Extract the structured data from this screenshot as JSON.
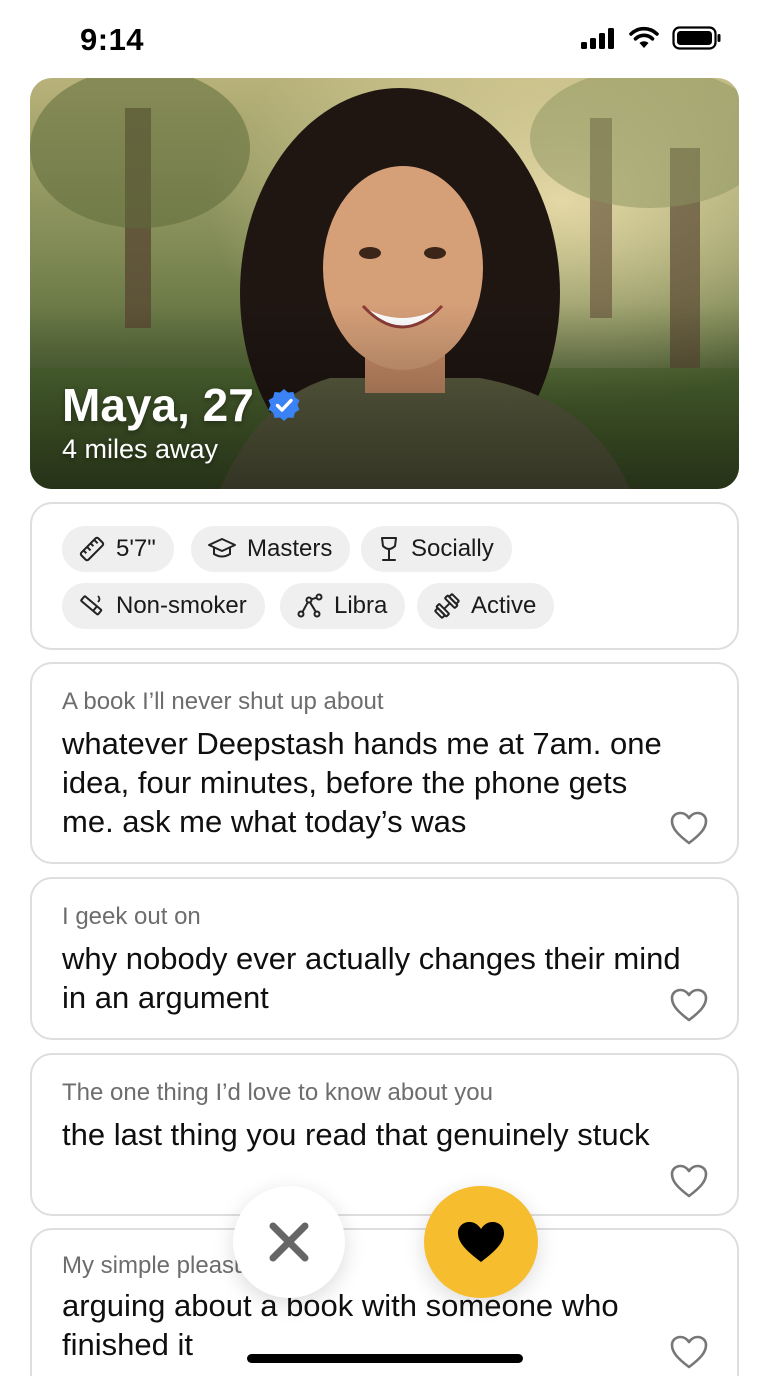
{
  "status_bar": {
    "time": "9:14"
  },
  "profile": {
    "name_age": "Maya, 27",
    "distance": "4 miles away"
  },
  "chips": [
    {
      "label": "5'7\"",
      "icon": "ruler-icon"
    },
    {
      "label": "Masters",
      "icon": "graduation-cap-icon"
    },
    {
      "label": "Socially",
      "icon": "wine-glass-icon"
    },
    {
      "label": "Non-smoker",
      "icon": "no-smoking-icon"
    },
    {
      "label": "Libra",
      "icon": "zodiac-constellation-icon"
    },
    {
      "label": "Active",
      "icon": "dumbbell-icon"
    }
  ],
  "prompts": [
    {
      "label": "A book I’ll never shut up about",
      "answer": "whatever Deepstash hands me at 7am. one idea, four minutes, before the phone gets me. ask me what today’s was"
    },
    {
      "label": "I geek out on",
      "answer": "why nobody ever actually changes their mind in an argument"
    },
    {
      "label": "The one thing I’d love to know about you",
      "answer": "the last thing you read that genuinely stuck"
    },
    {
      "label": "My simple pleasure",
      "answer": "arguing about a book with someone who finished it"
    }
  ],
  "colors": {
    "accent_like": "#f6bd2f",
    "verified_badge": "#3b82f6",
    "chip_bg": "#efefef",
    "card_border": "#dedede"
  },
  "actions": {
    "pass_icon": "close-icon",
    "like_icon": "heart-icon"
  }
}
